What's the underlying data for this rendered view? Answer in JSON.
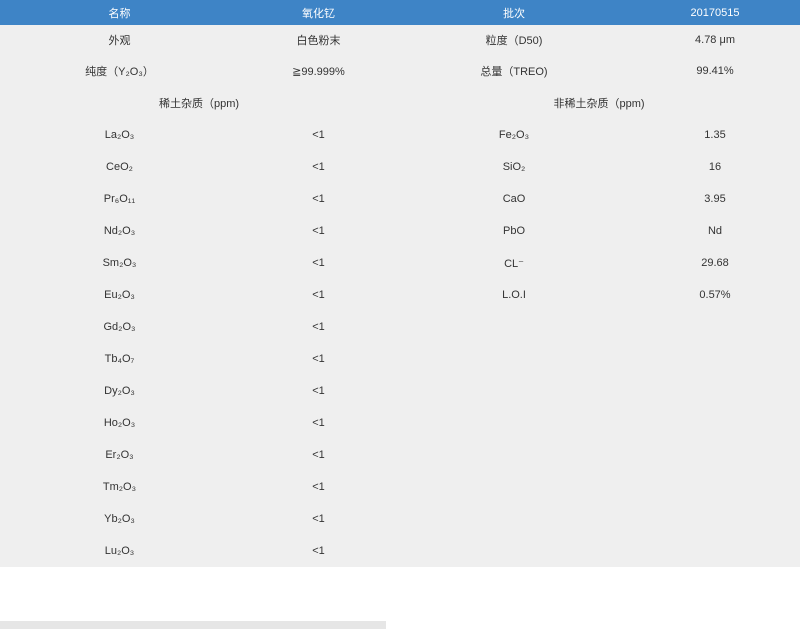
{
  "header": {
    "col1": "名称",
    "col2": "氧化钇",
    "col3": "批次",
    "col4": "20170515"
  },
  "basic": [
    {
      "label1": "外观",
      "value1": "白色粉末",
      "label2": "粒度（D50)",
      "value2": "4.78 μm"
    },
    {
      "label1": "纯度（Y₂O₃）",
      "value1": "≧99.999%",
      "label2": "总量（TREO)",
      "value2": "99.41%"
    }
  ],
  "sections": {
    "rare_earth": "稀土杂质（ppm)",
    "non_rare_earth": "非稀土杂质（ppm)"
  },
  "impurities": [
    {
      "re_name": "La₂O₃",
      "re_value": "<1",
      "nre_name": "Fe₂O₃",
      "nre_value": "1.35"
    },
    {
      "re_name": "CeO₂",
      "re_value": "<1",
      "nre_name": "SiO₂",
      "nre_value": "16"
    },
    {
      "re_name": "Pr₆O₁₁",
      "re_value": "<1",
      "nre_name": "CaO",
      "nre_value": "3.95"
    },
    {
      "re_name": "Nd₂O₃",
      "re_value": "<1",
      "nre_name": "PbO",
      "nre_value": "Nd"
    },
    {
      "re_name": "Sm₂O₃",
      "re_value": "<1",
      "nre_name": "CL⁻",
      "nre_value": "29.68"
    },
    {
      "re_name": "Eu₂O₃",
      "re_value": "<1",
      "nre_name": "L.O.I",
      "nre_value": "0.57%"
    },
    {
      "re_name": "Gd₂O₃",
      "re_value": "<1",
      "nre_name": "",
      "nre_value": ""
    },
    {
      "re_name": "Tb₄O₇",
      "re_value": "<1",
      "nre_name": "",
      "nre_value": ""
    },
    {
      "re_name": "Dy₂O₃",
      "re_value": "<1",
      "nre_name": "",
      "nre_value": ""
    },
    {
      "re_name": "Ho₂O₃",
      "re_value": "<1",
      "nre_name": "",
      "nre_value": ""
    },
    {
      "re_name": "Er₂O₃",
      "re_value": "<1",
      "nre_name": "",
      "nre_value": ""
    },
    {
      "re_name": "Tm₂O₃",
      "re_value": "<1",
      "nre_name": "",
      "nre_value": ""
    },
    {
      "re_name": "Yb₂O₃",
      "re_value": "<1",
      "nre_name": "",
      "nre_value": ""
    },
    {
      "re_name": "Lu₂O₃",
      "re_value": "<1",
      "nre_name": "",
      "nre_value": ""
    }
  ],
  "colors": {
    "header_bg": "#3e84c6",
    "table_bg": "#efefef",
    "text": "#333333"
  }
}
